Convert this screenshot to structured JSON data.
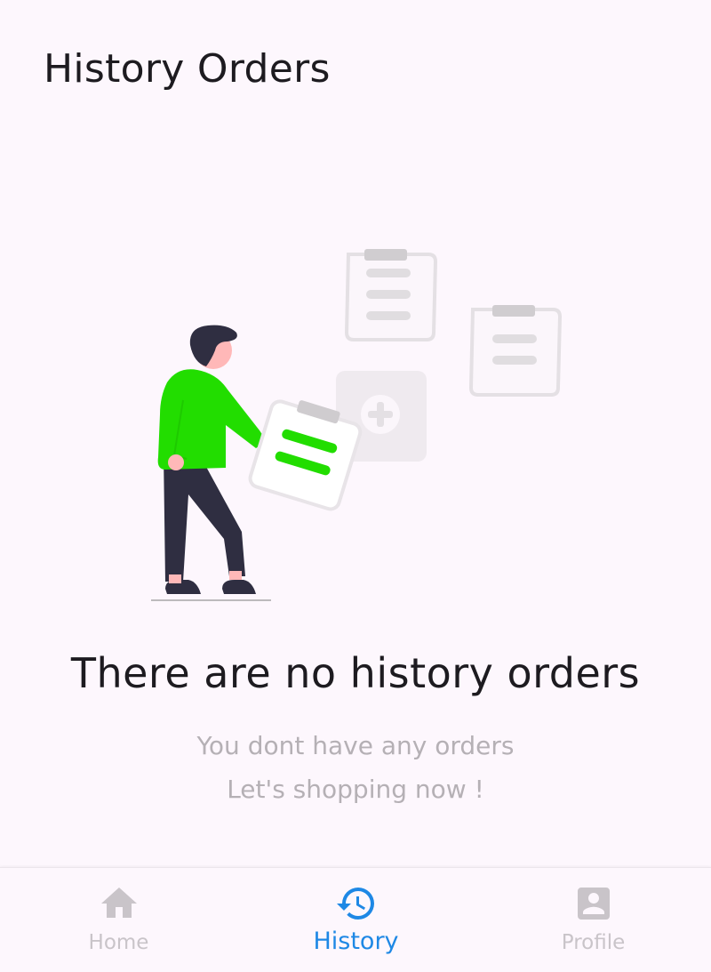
{
  "header": {
    "title": "History Orders"
  },
  "empty_state": {
    "title": "There are no history orders",
    "subtitle_line1": "You dont have any orders",
    "subtitle_line2": "Let's shopping now !"
  },
  "bottom_nav": {
    "active": "History",
    "items": [
      {
        "label": "Home",
        "icon": "home-icon"
      },
      {
        "label": "History",
        "icon": "history-icon"
      },
      {
        "label": "Profile",
        "icon": "profile-icon"
      }
    ]
  },
  "colors": {
    "background": "#fdf7fd",
    "active": "#1e88e5",
    "inactive": "#c9c4c9",
    "accent_green": "#22dd00",
    "text_dark": "#1d1b20",
    "text_muted": "#b5b0b5"
  }
}
